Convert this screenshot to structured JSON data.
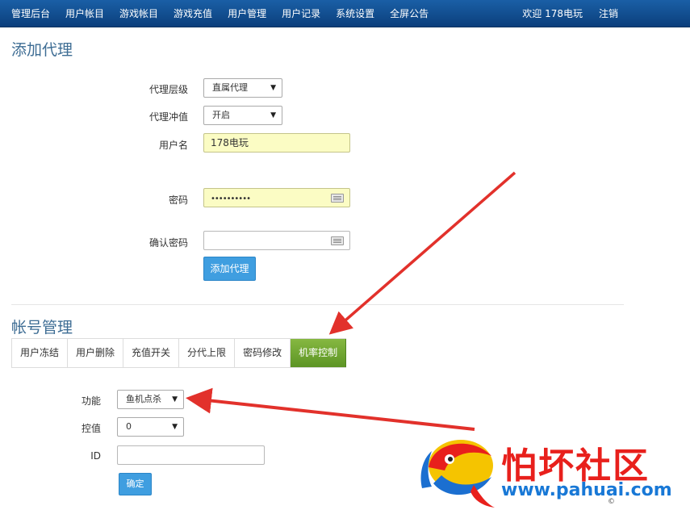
{
  "nav": {
    "items": [
      "管理后台",
      "用户帐目",
      "游戏帐目",
      "游戏充值",
      "用户管理",
      "用户记录",
      "系统设置",
      "全屏公告"
    ],
    "welcome": "欢迎 178电玩",
    "logout": "注销"
  },
  "add_agent": {
    "title": "添加代理",
    "level_label": "代理层级",
    "level_value": "直属代理",
    "recharge_label": "代理冲值",
    "recharge_value": "开启",
    "username_label": "用户名",
    "username_value": "178电玩",
    "password_label": "密码",
    "password_value": "••••••••••",
    "confirm_label": "确认密码",
    "confirm_value": "",
    "submit_label": "添加代理"
  },
  "account": {
    "title": "帐号管理",
    "tabs": [
      "用户冻结",
      "用户删除",
      "充值开关",
      "分代上限",
      "密码修改",
      "机率控制"
    ],
    "active_tab": "机率控制",
    "function_label": "功能",
    "function_value": "鱼机点杀",
    "control_label": "控值",
    "control_value": "0",
    "id_label": "ID",
    "id_value": "",
    "confirm_label": "确定"
  },
  "watermark": {
    "title": "怕坏社区",
    "url": "www.pahuai.com",
    "symbol": "©"
  },
  "colors": {
    "nav_bg": "#0d4a8a",
    "section_title": "#3e6d94",
    "primary_button": "#3f9ee0",
    "active_tab": "#6ea532",
    "autofill_bg": "#fbfcc4",
    "annotation_arrow": "#e2312b",
    "logo_red": "#e8201c",
    "logo_blue": "#1878d6"
  },
  "icons": [
    "keyboard-icon",
    "dropdown-arrow-icon",
    "annotation-arrow",
    "logo-fish-icon"
  ]
}
